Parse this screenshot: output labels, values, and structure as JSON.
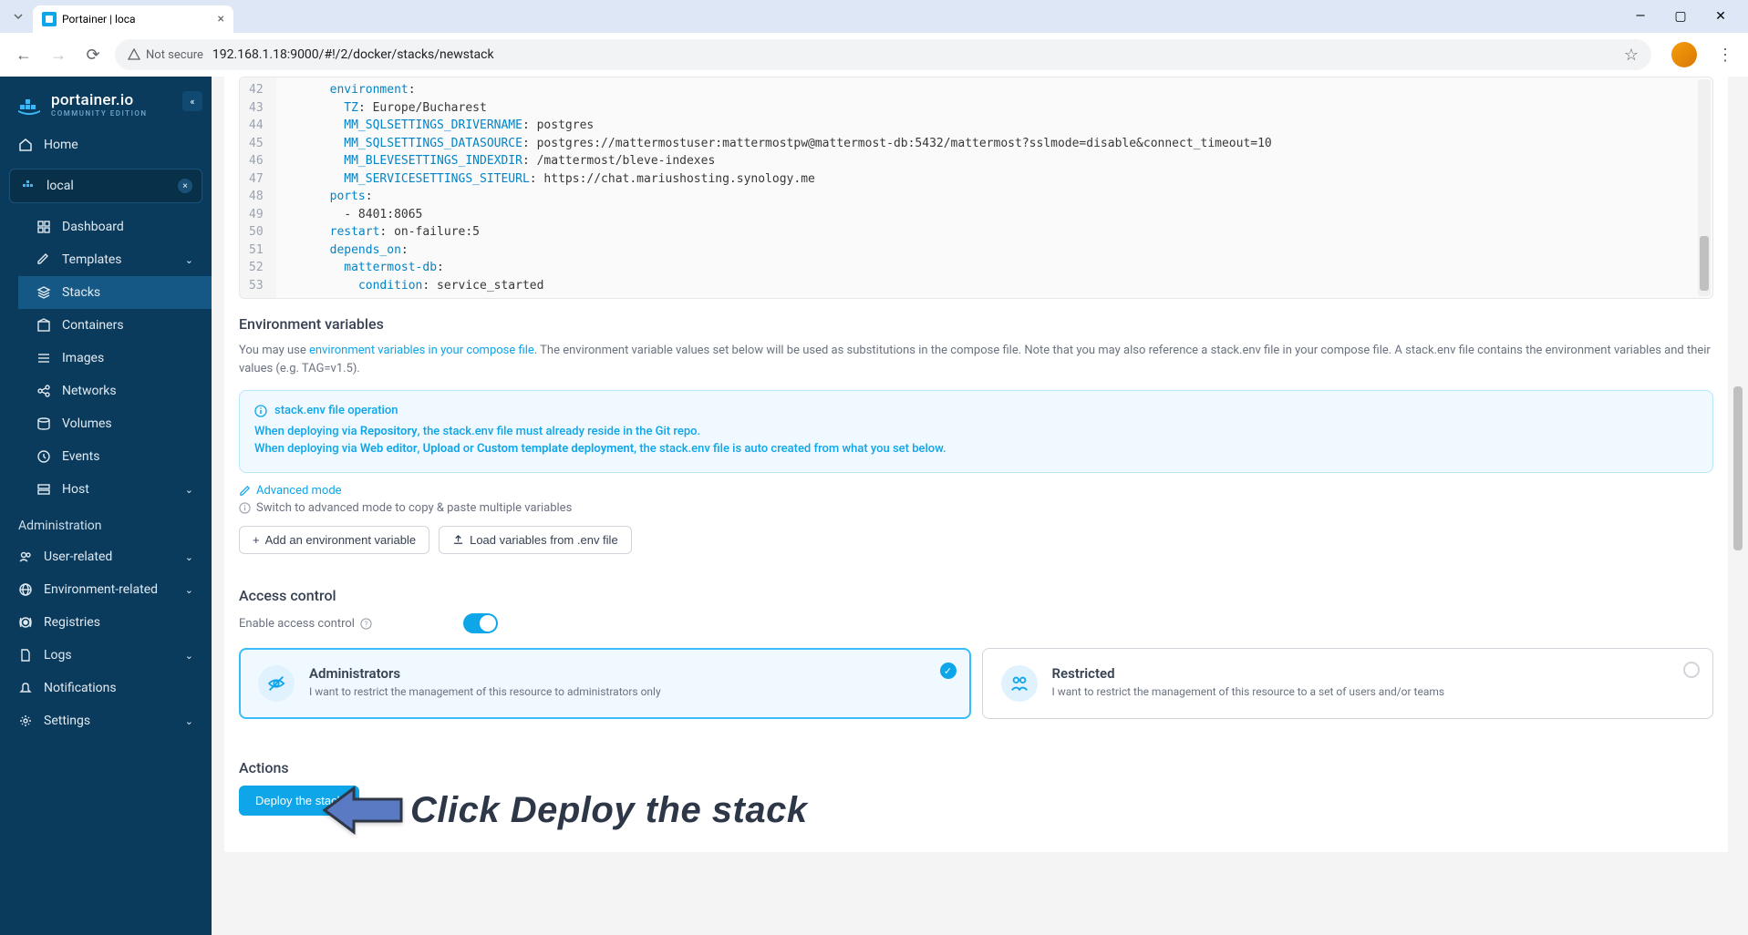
{
  "browser": {
    "tab_title": "Portainer | loca",
    "url": "192.168.1.18:9000/#!/2/docker/stacks/newstack",
    "not_secure": "Not secure"
  },
  "sidebar": {
    "logo_main": "portainer.io",
    "logo_sub": "COMMUNITY EDITION",
    "home": "Home",
    "env": "local",
    "items": [
      {
        "label": "Dashboard",
        "icon": "dashboard"
      },
      {
        "label": "Templates",
        "icon": "edit",
        "chevron": true
      },
      {
        "label": "Stacks",
        "icon": "layers",
        "active": true
      },
      {
        "label": "Containers",
        "icon": "box"
      },
      {
        "label": "Images",
        "icon": "list"
      },
      {
        "label": "Networks",
        "icon": "share"
      },
      {
        "label": "Volumes",
        "icon": "database"
      },
      {
        "label": "Events",
        "icon": "clock"
      },
      {
        "label": "Host",
        "icon": "server",
        "chevron": true
      }
    ],
    "admin_label": "Administration",
    "admin_items": [
      {
        "label": "User-related",
        "icon": "users",
        "chevron": true
      },
      {
        "label": "Environment-related",
        "icon": "globe",
        "chevron": true
      },
      {
        "label": "Registries",
        "icon": "radio"
      },
      {
        "label": "Logs",
        "icon": "file",
        "chevron": true
      },
      {
        "label": "Notifications",
        "icon": "bell"
      },
      {
        "label": "Settings",
        "icon": "gear",
        "chevron": true
      }
    ]
  },
  "editor": {
    "lines": [
      {
        "n": 42,
        "indent": 3,
        "key": "environment",
        "val": ""
      },
      {
        "n": 43,
        "indent": 4,
        "key": "TZ",
        "val": "Europe/Bucharest"
      },
      {
        "n": 44,
        "indent": 4,
        "key": "MM_SQLSETTINGS_DRIVERNAME",
        "val": "postgres"
      },
      {
        "n": 45,
        "indent": 4,
        "key": "MM_SQLSETTINGS_DATASOURCE",
        "val": "postgres://mattermostuser:mattermostpw@mattermost-db:5432/mattermost?sslmode=disable&connect_timeout=10"
      },
      {
        "n": 46,
        "indent": 4,
        "key": "MM_BLEVESETTINGS_INDEXDIR",
        "val": "/mattermost/bleve-indexes"
      },
      {
        "n": 47,
        "indent": 4,
        "key": "MM_SERVICESETTINGS_SITEURL",
        "val": "https://chat.mariushosting.synology.me"
      },
      {
        "n": 48,
        "indent": 3,
        "key": "ports",
        "val": ""
      },
      {
        "n": 49,
        "indent": 4,
        "raw": "- 8401:8065"
      },
      {
        "n": 50,
        "indent": 3,
        "key": "restart",
        "val": "on-failure:5"
      },
      {
        "n": 51,
        "indent": 3,
        "key": "depends_on",
        "val": ""
      },
      {
        "n": 52,
        "indent": 4,
        "key": "mattermost-db",
        "val": ""
      },
      {
        "n": 53,
        "indent": 5,
        "key": "condition",
        "val": "service_started"
      }
    ]
  },
  "env_section": {
    "title": "Environment variables",
    "help_1": "You may use ",
    "help_link": "environment variables in your compose file",
    "help_2": ". The environment variable values set below will be used as substitutions in the compose file. Note that you may also reference a stack.env file in your compose file. A stack.env file contains the environment variables and their values (e.g. TAG=v1.5).",
    "info_title": "stack.env file operation",
    "info_l1a": "When deploying via ",
    "info_l1b": "Repository",
    "info_l1c": ", the stack.env file must already reside in the Git repo.",
    "info_l2a": "When deploying via ",
    "info_l2b": "Web editor",
    "info_l2c": ", ",
    "info_l2d": "Upload",
    "info_l2e": " or ",
    "info_l2f": "Custom template deployment",
    "info_l2g": ", the stack.env file is auto created from what you set below.",
    "advanced": "Advanced mode",
    "hint": "Switch to advanced mode to copy & paste multiple variables",
    "btn_add": "Add an environment variable",
    "btn_load": "Load variables from .env file"
  },
  "access": {
    "title": "Access control",
    "enable_label": "Enable access control",
    "card_admin_title": "Administrators",
    "card_admin_desc": "I want to restrict the management of this resource to administrators only",
    "card_restrict_title": "Restricted",
    "card_restrict_desc": "I want to restrict the management of this resource to a set of users and/or teams"
  },
  "actions": {
    "title": "Actions",
    "deploy": "Deploy the stack"
  },
  "annotation": "Click Deploy the stack"
}
